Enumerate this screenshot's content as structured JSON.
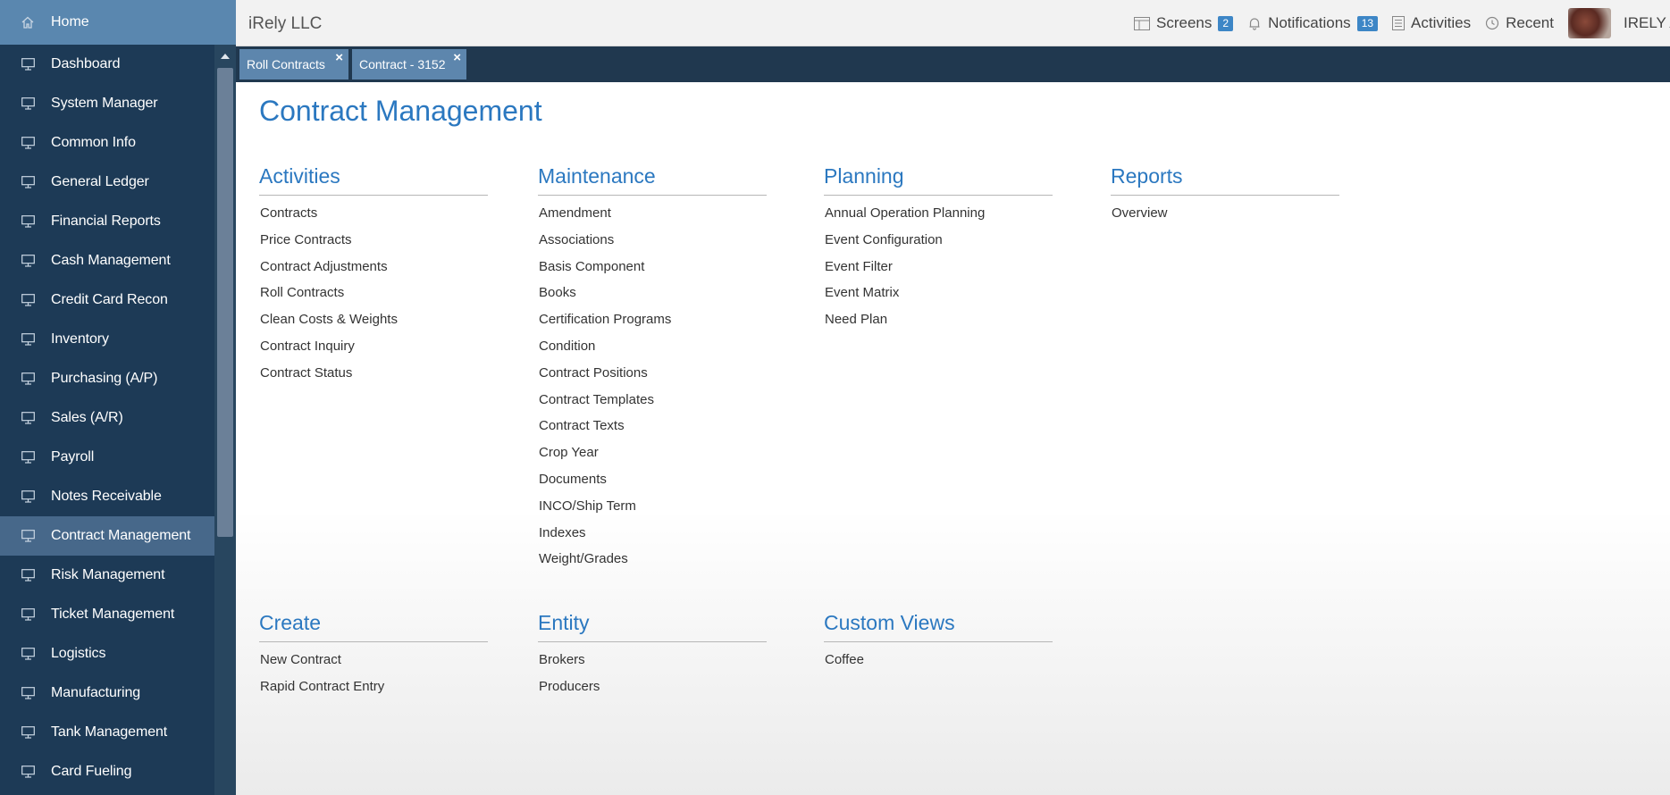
{
  "sidebar": {
    "home_label": "Home",
    "items": [
      {
        "label": "Dashboard",
        "name": "dashboard"
      },
      {
        "label": "System Manager",
        "name": "system-manager"
      },
      {
        "label": "Common Info",
        "name": "common-info"
      },
      {
        "label": "General Ledger",
        "name": "general-ledger"
      },
      {
        "label": "Financial Reports",
        "name": "financial-reports"
      },
      {
        "label": "Cash Management",
        "name": "cash-management"
      },
      {
        "label": "Credit Card Recon",
        "name": "credit-card-recon"
      },
      {
        "label": "Inventory",
        "name": "inventory"
      },
      {
        "label": "Purchasing (A/P)",
        "name": "purchasing"
      },
      {
        "label": "Sales (A/R)",
        "name": "sales"
      },
      {
        "label": "Payroll",
        "name": "payroll"
      },
      {
        "label": "Notes Receivable",
        "name": "notes-receivable"
      },
      {
        "label": "Contract Management",
        "name": "contract-management",
        "active": true
      },
      {
        "label": "Risk Management",
        "name": "risk-management"
      },
      {
        "label": "Ticket Management",
        "name": "ticket-management"
      },
      {
        "label": "Logistics",
        "name": "logistics"
      },
      {
        "label": "Manufacturing",
        "name": "manufacturing"
      },
      {
        "label": "Tank Management",
        "name": "tank-management"
      },
      {
        "label": "Card Fueling",
        "name": "card-fueling"
      }
    ]
  },
  "topbar": {
    "company": "iRely LLC",
    "screens_label": "Screens",
    "screens_count": "2",
    "notifications_label": "Notifications",
    "notifications_count": "13",
    "activities_label": "Activities",
    "recent_label": "Recent",
    "user_name": "IRELY A"
  },
  "tabs": [
    {
      "label": "Roll Contracts",
      "close": "×"
    },
    {
      "label": "Contract - 3152",
      "close": "×"
    }
  ],
  "main": {
    "title": "Contract Management",
    "sections": {
      "activities": {
        "heading": "Activities",
        "links": [
          "Contracts",
          "Price Contracts",
          "Contract Adjustments",
          "Roll Contracts",
          "Clean Costs & Weights",
          "Contract Inquiry",
          "Contract Status"
        ]
      },
      "maintenance": {
        "heading": "Maintenance",
        "links": [
          "Amendment",
          "Associations",
          "Basis Component",
          "Books",
          "Certification Programs",
          "Condition",
          "Contract Positions",
          "Contract Templates",
          "Contract Texts",
          "Crop Year",
          "Documents",
          "INCO/Ship Term",
          "Indexes",
          "Weight/Grades"
        ]
      },
      "planning": {
        "heading": "Planning",
        "links": [
          "Annual Operation Planning",
          "Event Configuration",
          "Event Filter",
          "Event Matrix",
          "Need Plan"
        ]
      },
      "reports": {
        "heading": "Reports",
        "links": [
          "Overview"
        ]
      },
      "create": {
        "heading": "Create",
        "links": [
          "New Contract",
          "Rapid Contract Entry"
        ]
      },
      "entity": {
        "heading": "Entity",
        "links": [
          "Brokers",
          "Producers"
        ]
      },
      "custom_views": {
        "heading": "Custom Views",
        "links": [
          "Coffee"
        ]
      }
    }
  },
  "colors": {
    "sidebar_bg": "#1d3a56",
    "home_bg": "#5a87af",
    "active_item_bg": "#47688a",
    "tab_bg": "#5d86ad",
    "heading_blue": "#2b78c0",
    "badge_blue": "#3d86c6"
  },
  "icons": {
    "home": "home-icon",
    "nav_item": "monitor-icon",
    "screens": "window-icon",
    "notifications": "bell-icon",
    "activities": "list-icon",
    "recent": "history-icon",
    "tab_close": "close-icon",
    "scroll_up": "arrow-up-icon"
  }
}
